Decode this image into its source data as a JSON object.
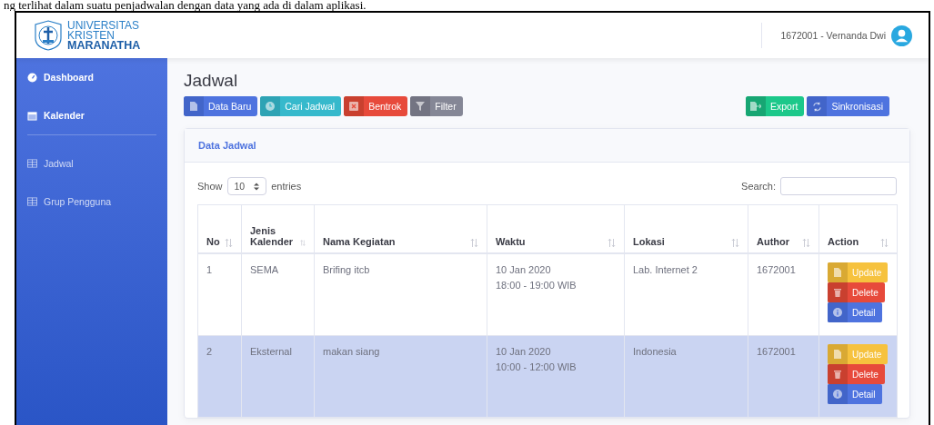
{
  "caption": "ng terlihat dalam suatu penjadwalan dengan data yang ada di dalam aplikasi.",
  "header": {
    "logo": [
      "UNIVERSITAS",
      "KRISTEN",
      "MARANATHA"
    ],
    "user": "1672001 - Vernanda Dwi"
  },
  "sidebar": {
    "items": [
      {
        "label": "Dashboard",
        "kind": "main"
      },
      {
        "label": "Kalender",
        "kind": "main"
      },
      {
        "label": "Jadwal",
        "kind": "sub"
      },
      {
        "label": "Grup Pengguna",
        "kind": "sub"
      }
    ]
  },
  "page_title": "Jadwal",
  "toolbar": {
    "left": [
      {
        "label": "Data Baru",
        "kind": "primary"
      },
      {
        "label": "Cari Jadwal",
        "kind": "info"
      },
      {
        "label": "Bentrok",
        "kind": "danger"
      },
      {
        "label": "Filter",
        "kind": "secondary"
      }
    ],
    "right": [
      {
        "label": "Export",
        "kind": "success"
      },
      {
        "label": "Sinkronisasi",
        "kind": "primary"
      }
    ]
  },
  "card": {
    "title": "Data Jadwal",
    "show_label": "Show",
    "entries_value": "10",
    "entries_label": "entries",
    "search_label": "Search:"
  },
  "table": {
    "columns": [
      "No",
      "Jenis Kalender",
      "Nama Kegiatan",
      "Waktu",
      "Lokasi",
      "Author",
      "Action"
    ],
    "rows": [
      {
        "selected": false,
        "cells": [
          "1",
          "SEMA",
          "Brifing itcb",
          "10 Jan 2020\n18:00 - 19:00 WIB",
          "Lab. Internet 2",
          "1672001"
        ],
        "actions": [
          {
            "label": "Update",
            "kind": "warning"
          },
          {
            "label": "Delete",
            "kind": "danger"
          },
          {
            "label": "Detail",
            "kind": "primary"
          }
        ]
      },
      {
        "selected": true,
        "cells": [
          "2",
          "Eksternal",
          "makan siang",
          "10 Jan 2020\n10:00 - 12:00 WIB",
          "Indonesia",
          "1672001"
        ],
        "actions": [
          {
            "label": "Update",
            "kind": "warning"
          },
          {
            "label": "Delete",
            "kind": "danger"
          },
          {
            "label": "Detail",
            "kind": "primary"
          }
        ]
      }
    ]
  }
}
